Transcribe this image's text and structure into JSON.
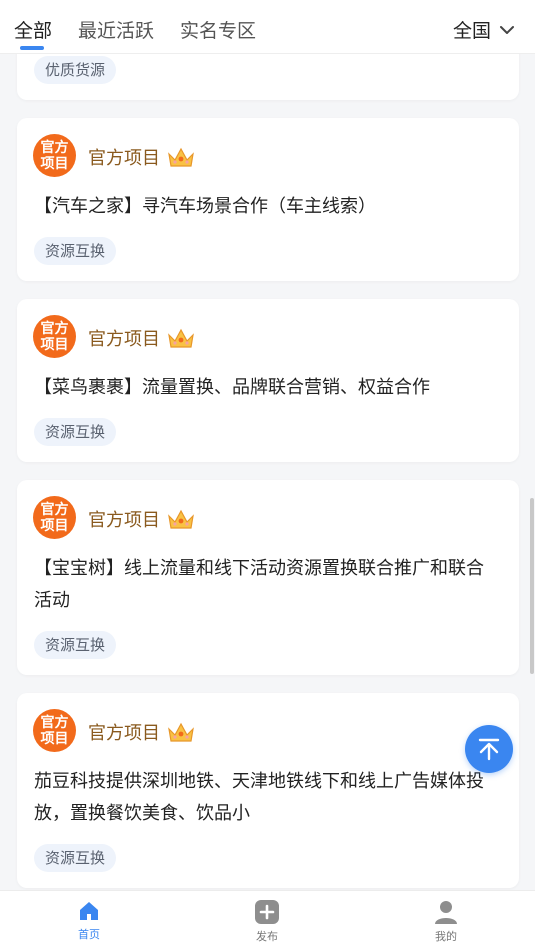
{
  "tabs": [
    {
      "label": "全部",
      "active": true
    },
    {
      "label": "最近活跃",
      "active": false
    },
    {
      "label": "实名专区",
      "active": false
    }
  ],
  "region": {
    "label": "全国",
    "icon": "chevron-down-icon"
  },
  "partial_card": {
    "tag": "优质货源"
  },
  "cards": [
    {
      "badge": "官方项目",
      "author": "官方项目",
      "title": "【汽车之家】寻汽车场景合作（车主线索）",
      "tag": "资源互换"
    },
    {
      "badge": "官方项目",
      "author": "官方项目",
      "title": "【菜鸟裹裹】流量置换、品牌联合营销、权益合作",
      "tag": "资源互换"
    },
    {
      "badge": "官方项目",
      "author": "官方项目",
      "title": "【宝宝树】线上流量和线下活动资源置换联合推广和联合活动",
      "tag": "资源互换"
    },
    {
      "badge": "官方项目",
      "author": "官方项目",
      "title": "茄豆科技提供深圳地铁、天津地铁线下和线上广告媒体投放，置换餐饮美食、饮品小",
      "tag": "资源互换"
    }
  ],
  "bottom_nav": [
    {
      "label": "首页",
      "icon": "home-icon",
      "active": true
    },
    {
      "label": "发布",
      "icon": "add-icon",
      "active": false
    },
    {
      "label": "我的",
      "icon": "user-icon",
      "active": false
    }
  ],
  "colors": {
    "accent": "#3a86f0",
    "badge": "#f26a1b",
    "author": "#8a5a1e",
    "tag_bg": "#eef3fb"
  }
}
